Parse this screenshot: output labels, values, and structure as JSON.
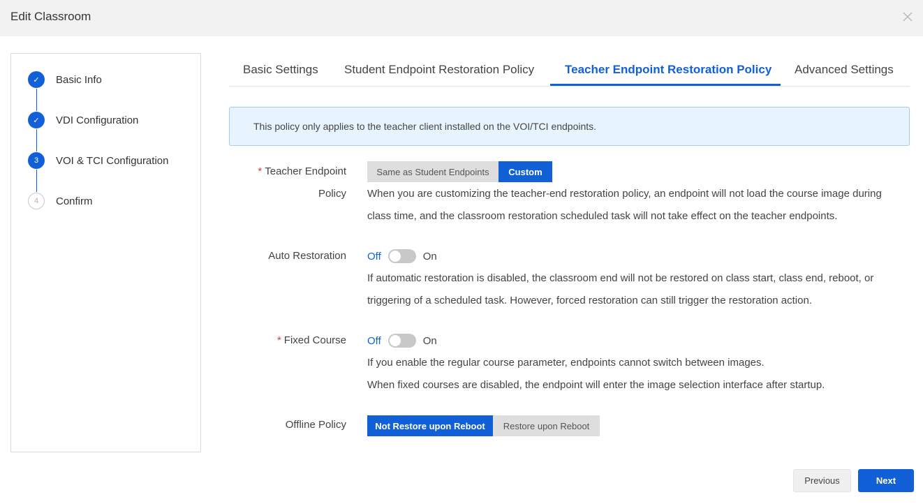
{
  "window": {
    "title": "Edit Classroom",
    "close_icon": "close-icon"
  },
  "steps": [
    {
      "label": "Basic Info",
      "state": "done",
      "marker": "✓"
    },
    {
      "label": "VDI Configuration",
      "state": "done",
      "marker": "✓"
    },
    {
      "label": "VOI & TCI Configuration",
      "state": "active",
      "marker": "3"
    },
    {
      "label": "Confirm",
      "state": "pending",
      "marker": "4"
    }
  ],
  "tabs": [
    {
      "label": "Basic Settings",
      "active": false
    },
    {
      "label": "Student Endpoint Restoration Policy",
      "active": false
    },
    {
      "label": "Teacher Endpoint Restoration Policy",
      "active": true
    },
    {
      "label": "Advanced Settings",
      "active": false
    }
  ],
  "notice": {
    "text": "This policy only applies to the teacher client installed on the VOI/TCI endpoints."
  },
  "form": {
    "teacher_policy": {
      "required_mark": "*",
      "label_line1": "Teacher Endpoint",
      "label_line2": "Policy",
      "options": [
        "Same as Student Endpoints",
        "Custom"
      ],
      "selected": "Custom",
      "desc_line1": "When you are customizing the teacher-end restoration policy, an endpoint will not load the course image during",
      "desc_line2": "class time, and the classroom restoration scheduled task will not take effect on the teacher endpoints."
    },
    "auto_restoration": {
      "label": "Auto Restoration",
      "off_label": "Off",
      "on_label": "On",
      "value": "Off",
      "desc_line1": "If automatic restoration is disabled, the classroom end will not be restored on class start, class end, reboot, or",
      "desc_line2": "triggering of a scheduled task. However, forced restoration can still trigger the restoration action."
    },
    "fixed_course": {
      "required_mark": "*",
      "label": "Fixed Course",
      "off_label": "Off",
      "on_label": "On",
      "value": "Off",
      "desc_line1": "If you enable the regular course parameter, endpoints cannot switch between images.",
      "desc_line2": "When fixed courses are disabled, the endpoint will enter the image selection interface after startup."
    },
    "offline_policy": {
      "label": "Offline Policy",
      "options": [
        "Not Restore upon Reboot",
        "Restore upon Reboot"
      ],
      "selected": "Not Restore upon Reboot"
    }
  },
  "footer": {
    "previous_label": "Previous",
    "next_label": "Next"
  },
  "colors": {
    "accent": "#1160d8",
    "required": "#e03b3b",
    "notice_bg": "#e8f4fd",
    "notice_border": "#9fd0f2"
  }
}
